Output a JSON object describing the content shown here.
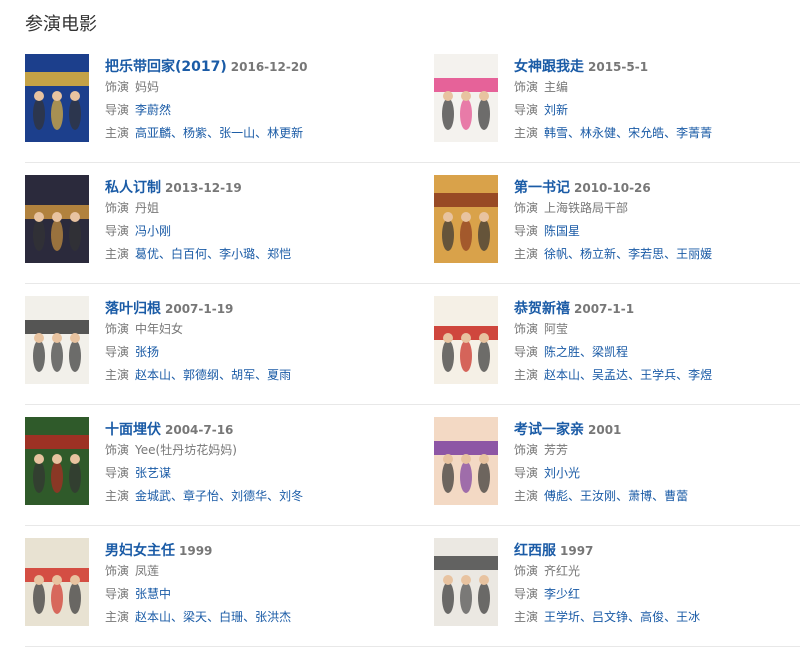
{
  "section_title": "参演电影",
  "labels": {
    "role": "饰演",
    "director": "导演",
    "cast": "主演"
  },
  "movies": [
    {
      "title": "把乐带回家(2017)",
      "date": "2016-12-20",
      "role": "妈妈",
      "director": [
        "李蔚然"
      ],
      "cast": [
        "高亚麟",
        "杨紫",
        "张一山",
        "林更新"
      ],
      "poster_colors": [
        "#1c3f8c",
        "#e2b43a"
      ]
    },
    {
      "title": "女神跟我走",
      "date": "2015-5-1",
      "role": "主编",
      "director": [
        "刘新"
      ],
      "cast": [
        "韩雪",
        "林永健",
        "宋允皓",
        "李菁菁"
      ],
      "poster_colors": [
        "#f4f2ee",
        "#e3498a"
      ]
    },
    {
      "title": "私人订制",
      "date": "2013-12-19",
      "role": "丹姐",
      "director": [
        "冯小刚"
      ],
      "cast": [
        "葛优",
        "白百何",
        "李小璐",
        "郑恺"
      ],
      "poster_colors": [
        "#2b2a3c",
        "#c9923e"
      ]
    },
    {
      "title": "第一书记",
      "date": "2010-10-26",
      "role": "上海铁路局干部",
      "director": [
        "陈国星"
      ],
      "cast": [
        "徐帆",
        "杨立新",
        "李若思",
        "王丽媛"
      ],
      "poster_colors": [
        "#d9a24a",
        "#8c3b1f"
      ]
    },
    {
      "title": "落叶归根",
      "date": "2007-1-19",
      "role": "中年妇女",
      "director": [
        "张扬"
      ],
      "cast": [
        "赵本山",
        "郭德纲",
        "胡军",
        "夏雨"
      ],
      "poster_colors": [
        "#f2f0ea",
        "#3a3a3a"
      ]
    },
    {
      "title": "恭贺新禧",
      "date": "2007-1-1",
      "role": "阿莹",
      "director": [
        "陈之胜",
        "梁凯程"
      ],
      "cast": [
        "赵本山",
        "吴孟达",
        "王学兵",
        "李煜"
      ],
      "poster_colors": [
        "#f5f0e6",
        "#c8281e"
      ]
    },
    {
      "title": "十面埋伏",
      "date": "2004-7-16",
      "role": "Yee(牡丹坊花妈妈)",
      "director": [
        "张艺谋"
      ],
      "cast": [
        "金城武",
        "章子怡",
        "刘德华",
        "刘冬"
      ],
      "poster_colors": [
        "#2f5a2a",
        "#b02a23"
      ]
    },
    {
      "title": "考试一家亲",
      "date": "2001",
      "role": "芳芳",
      "director": [
        "刘小光"
      ],
      "cast": [
        "傅彪",
        "王汝刚",
        "萧博",
        "曹蕾"
      ],
      "poster_colors": [
        "#f3d9c4",
        "#7a3ea0"
      ]
    },
    {
      "title": "男妇女主任",
      "date": "1999",
      "role": "凤莲",
      "director": [
        "张慧中"
      ],
      "cast": [
        "赵本山",
        "梁天",
        "白珊",
        "张洪杰"
      ],
      "poster_colors": [
        "#e8e2d2",
        "#d0342a"
      ]
    },
    {
      "title": "红西服",
      "date": "1997",
      "role": "齐红光",
      "director": [
        "李少红"
      ],
      "cast": [
        "王学圻",
        "吕文铮",
        "高俊",
        "王冰"
      ],
      "poster_colors": [
        "#ebe8e2",
        "#4a4a4a"
      ]
    }
  ]
}
